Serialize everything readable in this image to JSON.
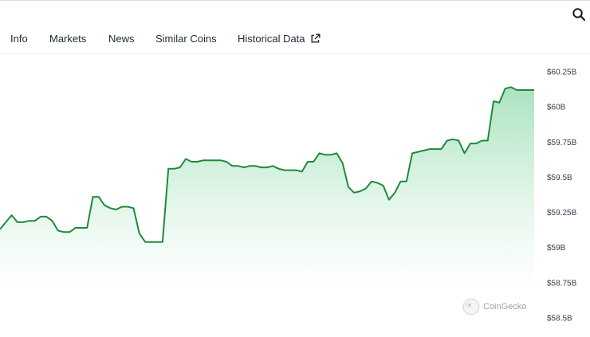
{
  "header": {
    "search_icon": "search-icon"
  },
  "tabs": [
    {
      "label": "Info"
    },
    {
      "label": "Markets"
    },
    {
      "label": "News"
    },
    {
      "label": "Similar Coins"
    },
    {
      "label": "Historical Data",
      "icon": "external-link-icon"
    }
  ],
  "watermark": {
    "label": "CoinGecko"
  },
  "colors": {
    "line": "#1f8a3a",
    "fill_top": "#a9e3bf",
    "fill_bottom": "#ffffff"
  },
  "chart_data": {
    "type": "area",
    "y_tick_labels": [
      "$60.25B",
      "$60B",
      "$59.75B",
      "$59.5B",
      "$59.25B",
      "$59B",
      "$58.75B",
      "$58.5B"
    ],
    "y_ticks": [
      60.25,
      60.0,
      59.75,
      59.5,
      59.25,
      59.0,
      58.75,
      58.5
    ],
    "ylim": [
      58.5,
      60.25
    ],
    "y_unit": "B USD",
    "grid": false,
    "series": [
      {
        "values": [
          59.13,
          59.18,
          59.23,
          59.18,
          59.18,
          59.19,
          59.19,
          59.22,
          59.22,
          59.19,
          59.12,
          59.11,
          59.11,
          59.14,
          59.14,
          59.14,
          59.36,
          59.36,
          59.3,
          59.28,
          59.27,
          59.29,
          59.29,
          59.28,
          59.1,
          59.04,
          59.04,
          59.04,
          59.04,
          59.56,
          59.56,
          59.57,
          59.63,
          59.61,
          59.61,
          59.62,
          59.62,
          59.62,
          59.62,
          59.61,
          59.58,
          59.58,
          59.57,
          59.58,
          59.58,
          59.57,
          59.57,
          59.58,
          59.56,
          59.55,
          59.55,
          59.55,
          59.54,
          59.61,
          59.61,
          59.67,
          59.66,
          59.66,
          59.67,
          59.6,
          59.43,
          59.39,
          59.4,
          59.42,
          59.47,
          59.46,
          59.44,
          59.34,
          59.39,
          59.47,
          59.47,
          59.67,
          59.68,
          59.69,
          59.7,
          59.7,
          59.7,
          59.76,
          59.77,
          59.76,
          59.67,
          59.74,
          59.74,
          59.76,
          59.76,
          60.04,
          60.03,
          60.13,
          60.14,
          60.12,
          60.12,
          60.12,
          60.12
        ]
      }
    ]
  }
}
